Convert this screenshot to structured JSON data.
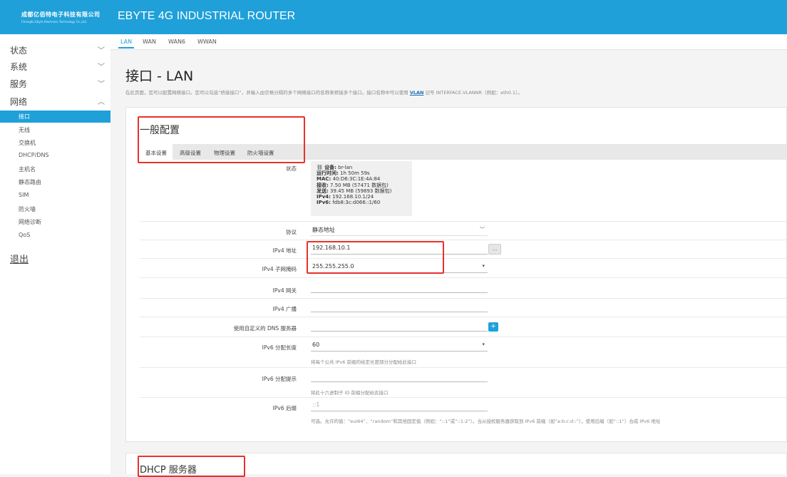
{
  "brand": {
    "name_cn": "成都亿佰特电子科技有限公司",
    "name_en": "Chengdu Ebyte Electronic Technology Co.,Ltd."
  },
  "app_title": "EBYTE 4G INDUSTRIAL ROUTER",
  "sidebar": {
    "menus": [
      {
        "label": "状态",
        "expanded": false
      },
      {
        "label": "系统",
        "expanded": false
      },
      {
        "label": "服务",
        "expanded": false
      },
      {
        "label": "网络",
        "expanded": true
      }
    ],
    "sub_items": [
      "接口",
      "无线",
      "交换机",
      "DHCP/DNS",
      "主机名",
      "静态路由",
      "SIM",
      "防火墙",
      "网络诊断",
      "QoS"
    ],
    "active_sub": "接口",
    "logout": "退出"
  },
  "top_tabs": [
    "LAN",
    "WAN",
    "WAN6",
    "WWAN"
  ],
  "active_top_tab": "LAN",
  "page": {
    "title": "接口 - LAN",
    "desc_pre": "在此页面，您可以配置网络接口。您可以勾选“桥接接口”，并输入由空格分隔的多个网络接口的名称来桥接多个接口。接口名称中可以使用 ",
    "desc_link": "VLAN",
    "desc_post": " 记号 INTERFACE.VLANNR（例如：eth0.1）。"
  },
  "general": {
    "title": "一般配置",
    "tabs": [
      "基本设置",
      "高级设置",
      "物理设置",
      "防火墙设置"
    ],
    "active_tab": "基本设置",
    "status_label": "状态",
    "status": {
      "device_label": "设备:",
      "device": "br-lan",
      "uptime_label": "运行时间:",
      "uptime": "1h 50m 59s",
      "mac_label": "MAC:",
      "mac": "40:D6:3C:1E:4A:84",
      "rx_label": "接收:",
      "rx": "7.50 MB (57471 数据包)",
      "tx_label": "发送:",
      "tx": "39.45 MB (59893 数据包)",
      "ipv4_label": "IPv4:",
      "ipv4": "192.168.10.1/24",
      "ipv6_label": "IPv6:",
      "ipv6": "fdb8:3c:d066::1/60"
    },
    "fields": {
      "protocol_label": "协议",
      "protocol": "静态地址",
      "ipv4_addr_label": "IPv4 地址",
      "ipv4_addr": "192.168.10.1",
      "ipv4_mask_label": "IPv4 子网掩码",
      "ipv4_mask": "255.255.255.0",
      "ipv4_gw_label": "IPv4 网关",
      "ipv4_gw": "",
      "ipv4_bc_label": "IPv4 广播",
      "ipv4_bc": "",
      "dns_label": "使用自定义的 DNS 服务器",
      "dns": "",
      "ipv6_len_label": "IPv6 分配长度",
      "ipv6_len": "60",
      "ipv6_len_hint": "将每个公共 IPv6 前缀的给定长度部分分配给此接口",
      "ipv6_hint_label": "IPv6 分配提示",
      "ipv6_hint": "",
      "ipv6_hint_hint": "将此十六进制子 ID 前缀分配给此接口",
      "ipv6_suffix_label": "IPv6 后缀",
      "ipv6_suffix_placeholder": "::1",
      "ipv6_suffix_hint": "可选。允许的值：“eui64”、“random”和其他固定值（例如：“::1”或“::1:2”）。当从授权服务器获取到 IPv6 前缀（如“a:b:c:d::”），使用后缀（如“::1”）合成 IPv6 地址"
    }
  },
  "dhcp_title": "DHCP 服务器",
  "colors": {
    "accent": "#1fa0d9",
    "highlight": "#e8312c"
  }
}
